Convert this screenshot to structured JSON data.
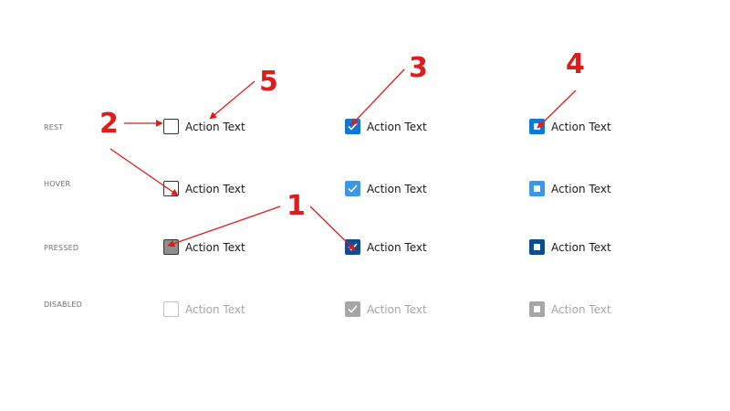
{
  "rows": {
    "rest": "REST",
    "hover": "HOVER",
    "pressed": "PRESSED",
    "disabled": "DISABLED"
  },
  "checkbox_label": "Action Text",
  "callouts": [
    "1",
    "2",
    "3",
    "4",
    "5"
  ],
  "colors": {
    "annotation": "#e01b1b",
    "checked_rest": "#0f78d4",
    "checked_hover": "#3f96e3",
    "checked_pressed": "#0c4d91",
    "disabled": "#a6a6a6"
  },
  "columns": {
    "unchecked": "unchecked",
    "checked": "checked",
    "indeterminate": "indeterminate"
  }
}
